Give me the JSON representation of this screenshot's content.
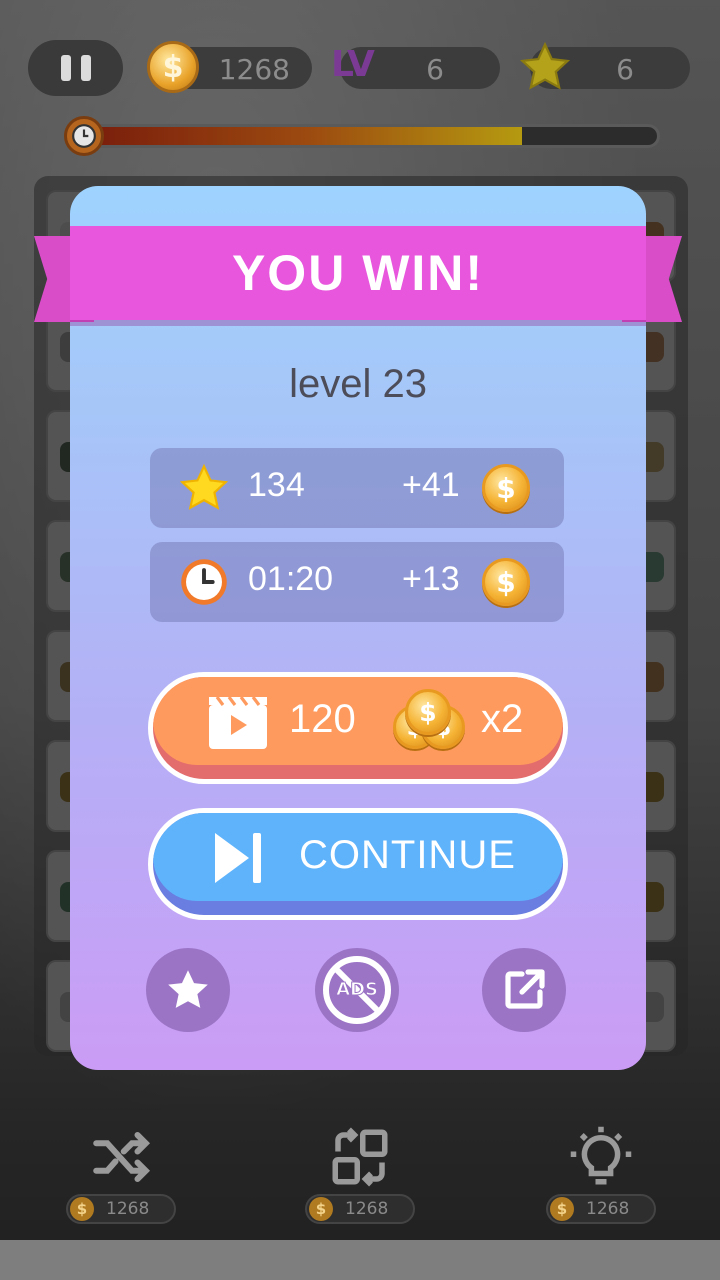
{
  "hud": {
    "coins": "1268",
    "level_badge": "LV",
    "level": "6",
    "stars": "6",
    "timer_progress": 0.76
  },
  "dialog": {
    "title": "YOU WIN!",
    "level_text": "level 23",
    "score_row": {
      "value": "134",
      "bonus": "+41"
    },
    "time_row": {
      "value": "01:20",
      "bonus": "+13"
    },
    "video_button": {
      "amount": "120",
      "multiplier": "x2"
    },
    "continue_label": "CONTINUE",
    "ads_label": "ADS"
  },
  "toolbar": {
    "shuffle_cost": "1268",
    "swap_cost": "1268",
    "hint_cost": "1268"
  },
  "colors": {
    "ribbon": "#e756dc",
    "video_button": "#ff9a5e",
    "continue_button": "#5fb3fb",
    "dialog_top": "#9fd3ff",
    "dialog_bottom": "#cb9cf5"
  },
  "icons": [
    "pause-icon",
    "coin-icon",
    "star-icon",
    "clock-icon",
    "video-icon",
    "next-icon",
    "rate-star-icon",
    "no-ads-icon",
    "share-icon",
    "shuffle-icon",
    "swap-icon",
    "hint-bulb-icon"
  ]
}
